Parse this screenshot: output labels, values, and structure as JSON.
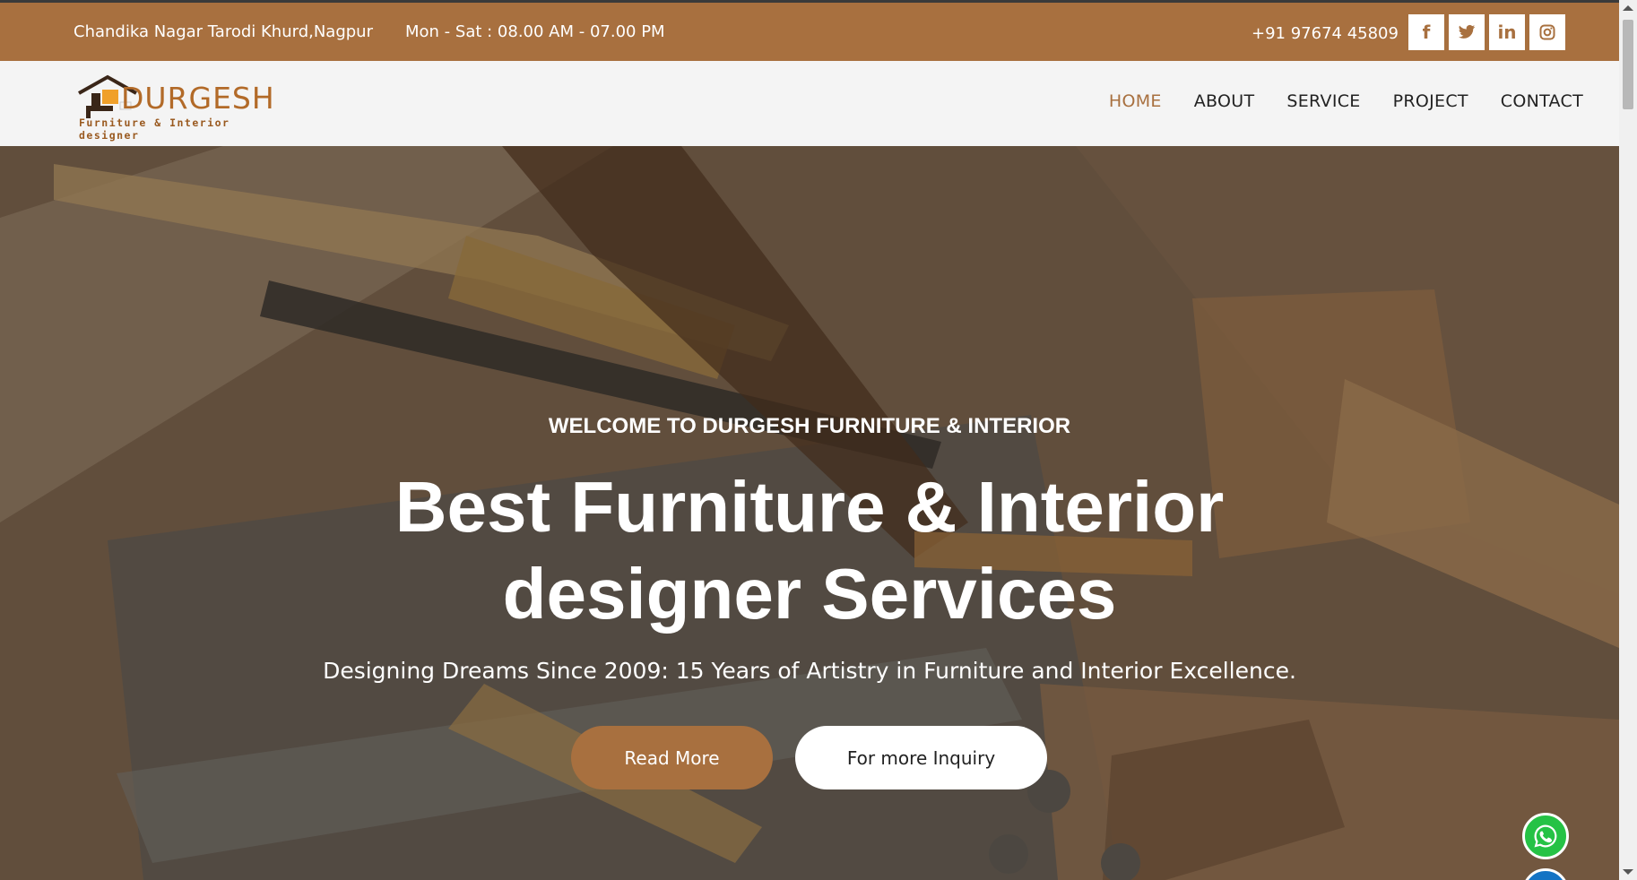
{
  "topbar": {
    "address": "Chandika Nagar Tarodi Khurd,Nagpur",
    "hours": "Mon - Sat : 08.00 AM - 07.00 PM",
    "phone": "+91 97674 45809",
    "socials": [
      {
        "icon": "facebook-icon",
        "glyph": "f"
      },
      {
        "icon": "twitter-icon",
        "glyph": "t"
      },
      {
        "icon": "linkedin-icon",
        "glyph": "in"
      },
      {
        "icon": "instagram-icon",
        "glyph": "◎"
      }
    ]
  },
  "logo": {
    "brand": "DURGESH",
    "tagline": "Furniture & Interior designer"
  },
  "nav": {
    "items": [
      {
        "label": "HOME",
        "active": true
      },
      {
        "label": "ABOUT",
        "active": false
      },
      {
        "label": "SERVICE",
        "active": false
      },
      {
        "label": "PROJECT",
        "active": false
      },
      {
        "label": "CONTACT",
        "active": false
      }
    ]
  },
  "hero": {
    "eyebrow": "WELCOME TO DURGESH FURNITURE & INTERIOR",
    "title_line1": "Best Furniture & Interior",
    "title_line2": "designer Services",
    "subtitle": "Designing Dreams Since 2009: 15 Years of Artistry in Furniture and Interior Excellence.",
    "read_more": "Read More",
    "inquiry": "For more Inquiry"
  },
  "floating": {
    "whatsapp_icon": "whatsapp-icon",
    "call_icon": "phone-call-icon"
  },
  "colors": {
    "accent": "#a8703f",
    "whatsapp": "#25c245",
    "call": "#1473c4"
  }
}
